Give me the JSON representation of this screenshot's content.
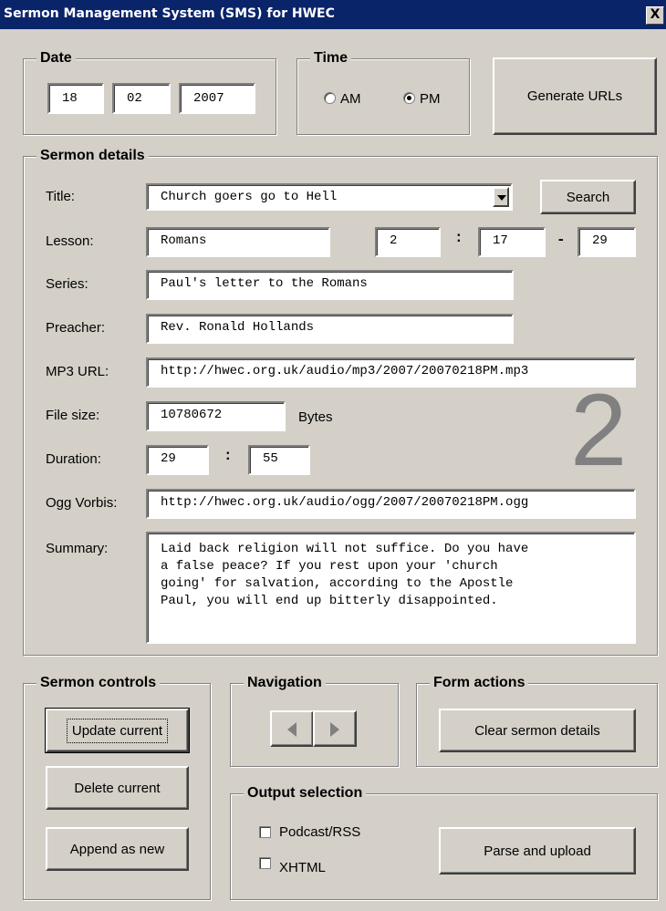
{
  "window": {
    "title": "Sermon Management System (SMS) for HWEC",
    "close_glyph": "X"
  },
  "date": {
    "legend": "Date",
    "day": "18",
    "month": "02",
    "year": "2007"
  },
  "time": {
    "legend": "Time",
    "am_label": "AM",
    "pm_label": "PM",
    "selected": "PM"
  },
  "generate_urls_label": "Generate URLs",
  "details": {
    "legend": "Sermon details",
    "title_label": "Title:",
    "title_value": "Church goers go to Hell",
    "search_label": "Search",
    "lesson_label": "Lesson:",
    "lesson_book": "Romans",
    "lesson_chapter": "2",
    "lesson_verse_from": "17",
    "lesson_verse_to": "29",
    "lesson_colon": ":",
    "lesson_dash": "-",
    "series_label": "Series:",
    "series_value": "Paul's letter to the Romans",
    "preacher_label": "Preacher:",
    "preacher_value": "Rev. Ronald Hollands",
    "mp3_label": "MP3 URL:",
    "mp3_value": "http://hwec.org.uk/audio/mp3/2007/20070218PM.mp3",
    "filesize_label": "File size:",
    "filesize_value": "10780672",
    "filesize_unit": "Bytes",
    "duration_label": "Duration:",
    "duration_min": "29",
    "duration_sec": "55",
    "duration_colon": ":",
    "ogg_label": "Ogg Vorbis:",
    "ogg_value": "http://hwec.org.uk/audio/ogg/2007/20070218PM.ogg",
    "summary_label": "Summary:",
    "summary_value": "Laid back religion will not suffice. Do you have\na false peace? If you rest upon your 'church\ngoing' for salvation, according to the Apostle\nPaul, you will end up bitterly disappointed.",
    "big_number": "2"
  },
  "controls": {
    "legend": "Sermon controls",
    "update_label": "Update current",
    "delete_label": "Delete current",
    "append_label": "Append as new"
  },
  "navigation": {
    "legend": "Navigation"
  },
  "form_actions": {
    "legend": "Form actions",
    "clear_label": "Clear sermon details"
  },
  "output": {
    "legend": "Output selection",
    "podcast_label": "Podcast/RSS",
    "podcast_checked": false,
    "xhtml_label": "XHTML",
    "xhtml_checked": false,
    "parse_label": "Parse and upload"
  }
}
